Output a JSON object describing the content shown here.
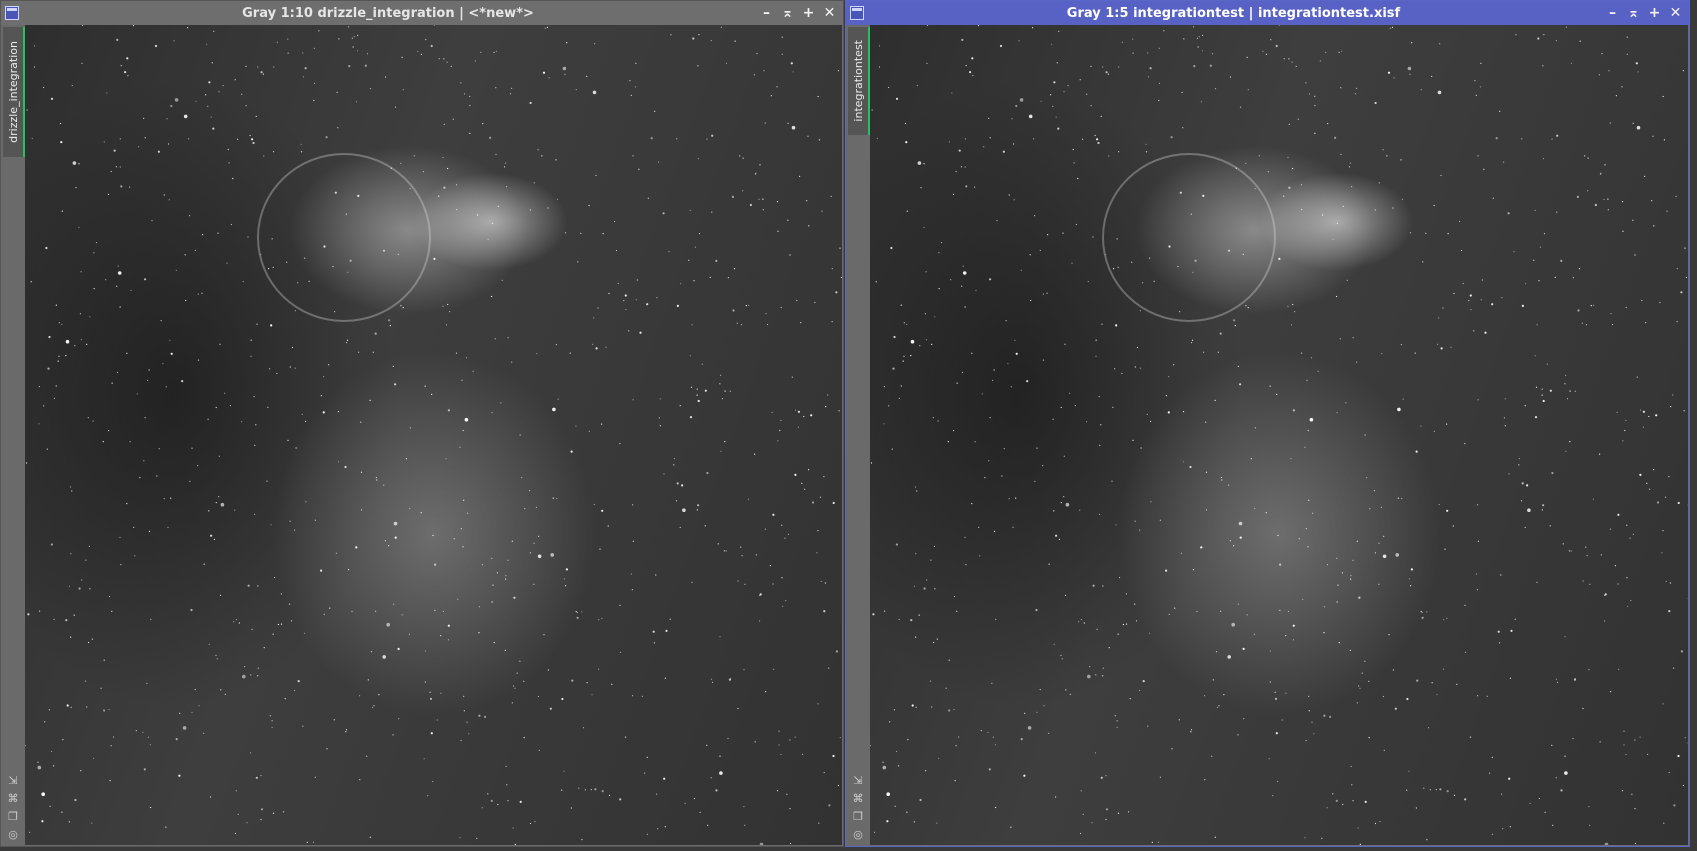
{
  "windows": [
    {
      "title": "Gray 1:10 drizzle_integration | <*new*>",
      "tab_label": "drizzle_integration",
      "active": false
    },
    {
      "title": "Gray 1:5 integrationtest | integrationtest.xisf",
      "tab_label": "integrationtest",
      "active": true
    }
  ],
  "controls": {
    "minimize": "–",
    "shade": "⌅",
    "maximize": "+",
    "close": "✕"
  },
  "tool_icons": [
    "fit-view-icon",
    "pan-icon",
    "clone-icon",
    "target-icon"
  ],
  "colors": {
    "active_title": "#5862c4",
    "inactive_title": "#6e6e6e",
    "tab_accent": "#27c25e"
  }
}
